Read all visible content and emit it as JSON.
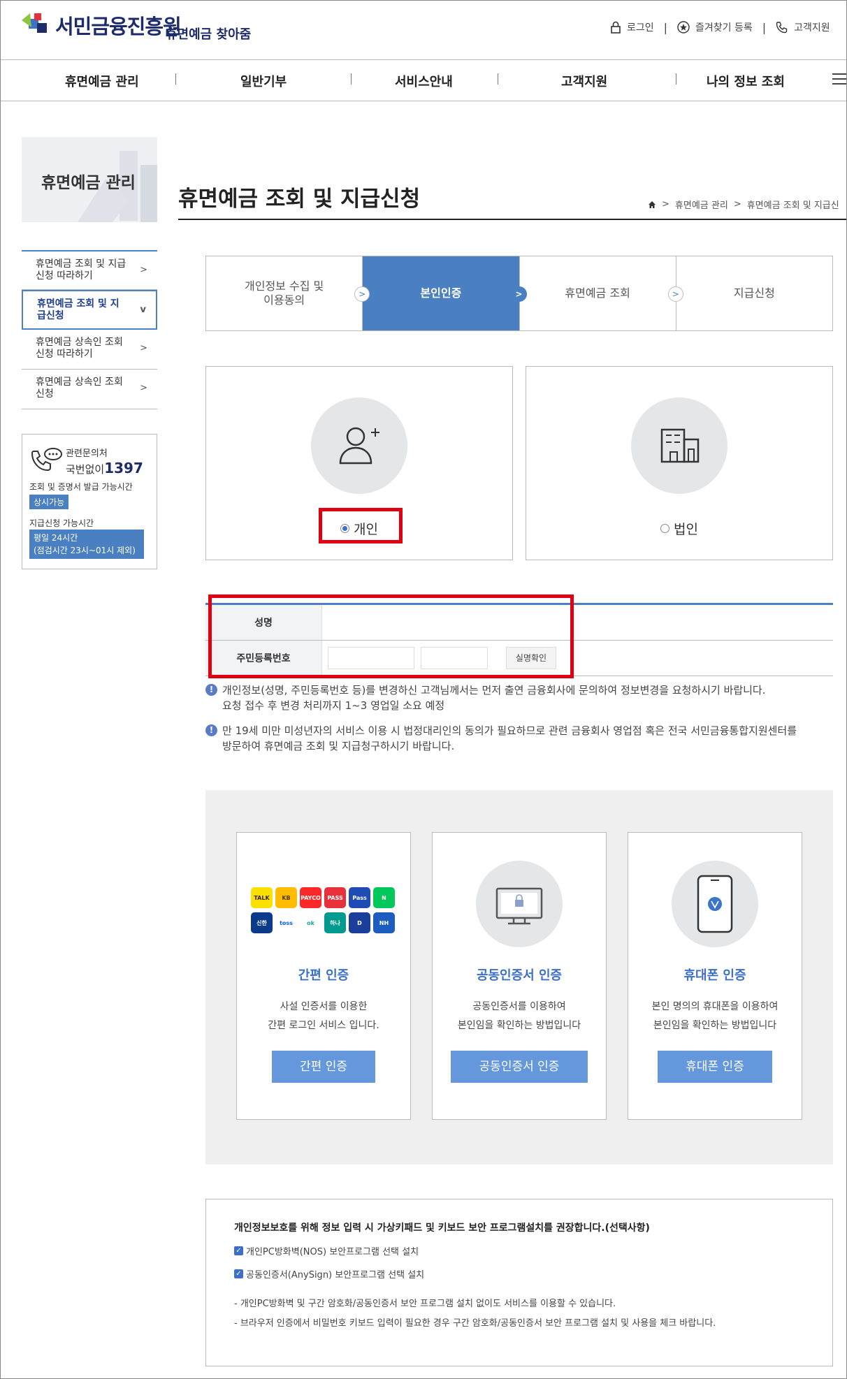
{
  "header": {
    "logo_text": "서민금융진흥원",
    "logo_sub": "휴면예금 찾아줌",
    "util": {
      "login": "로그인",
      "bookmark": "즐겨찾기 등록",
      "support": "고객지원"
    }
  },
  "gnb": [
    "휴면예금 관리",
    "일반기부",
    "서비스안내",
    "고객지원",
    "나의 정보 조회"
  ],
  "sidebar": {
    "title": "휴면예금 관리",
    "items": [
      {
        "label": "휴면예금 조회 및 지급신청 따라하기",
        "arrow": ">"
      },
      {
        "label": "휴면예금 조회 및 지급신청",
        "arrow": "v"
      },
      {
        "label": "휴면예금 상속인 조회신청 따라하기",
        "arrow": ">"
      },
      {
        "label": "휴면예금 상속인 조회신청",
        "arrow": ">"
      }
    ],
    "info": {
      "inquiry": "관련문의처",
      "no_area": "국번없이",
      "phone": "1397",
      "cert_time_label": "조회 및 증명서 발급 가능시간",
      "cert_time": "상시가능",
      "pay_time_label": "지급신청 가능시간",
      "pay_time_1": "평일 24시간",
      "pay_time_2": "(점검시간 23시~01시 제외)"
    }
  },
  "main": {
    "title": "휴면예금 조회 및 지급신청",
    "breadcrumb": [
      "휴면예금 관리",
      "휴면예금 조회 및 지급신"
    ],
    "steps": [
      {
        "label": "개인정보 수집 및 이용동의",
        "active": false
      },
      {
        "label": "본인인증",
        "active": true
      },
      {
        "label": "휴면예금 조회",
        "active": false
      },
      {
        "label": "지급신청",
        "active": false
      }
    ],
    "types": {
      "personal": "개인",
      "corporate": "법인",
      "selected": "개인"
    },
    "form": {
      "name_label": "성명",
      "name_value": "",
      "rrn_label": "주민등록번호",
      "rrn_value_1": "",
      "rrn_value_2": "",
      "verify_button": "실명확인"
    },
    "notes": [
      {
        "line1": "개인정보(성명, 주민등록번호 등)를 변경하신 고객님께서는 먼저 출연 금융회사에 문의하여 정보변경을 요청하시기 바랍니다.",
        "line2": "요청 접수 후 변경 처리까지 1~3 영업일 소요 예정"
      },
      {
        "line1": "만 19세 미만 미성년자의 서비스 이용 시 법정대리인의 동의가 필요하므로 관련 금융회사 영업점 혹은 전국 서민금융통합지원센터를",
        "line2": "방문하여 휴면예금 조회 및 지급청구하시기 바랍니다."
      }
    ],
    "auth": [
      {
        "title": "간편 인증",
        "desc1": "사설 인증서를 이용한",
        "desc2": "간편 로그인 서비스 입니다.",
        "button": "간편 인증"
      },
      {
        "title": "공동인증서 인증",
        "desc1": "공동인증서를 이용하여",
        "desc2": "본인임을 확인하는 방법입니다",
        "button": "공동인증서 인증"
      },
      {
        "title": "휴대폰 인증",
        "desc1": "본인 명의의 휴대폰을 이용하여",
        "desc2": "본인임을 확인하는 방법입니다",
        "button": "휴대폰 인증"
      }
    ],
    "apps": [
      {
        "label": "TALK",
        "color": "#fae100",
        "text_color": "#3c1e1e"
      },
      {
        "label": "KB",
        "color": "#ffbc00",
        "text_color": "#4a3a00"
      },
      {
        "label": "PAYCO",
        "color": "#fa2828",
        "text_color": "#ffffff"
      },
      {
        "label": "PASS",
        "color": "#e8303a",
        "text_color": "#ffffff"
      },
      {
        "label": "Pass",
        "color": "#1f4bb4",
        "text_color": "#ffffff"
      },
      {
        "label": "N",
        "color": "#03c75a",
        "text_color": "#ffffff"
      },
      {
        "label": "신한",
        "color": "#0a3a8a",
        "text_color": "#ffffff"
      },
      {
        "label": "toss",
        "color": "#ffffff",
        "text_color": "#0064ff"
      },
      {
        "label": "ok",
        "color": "#ffffff",
        "text_color": "#1aa58f"
      },
      {
        "label": "하나",
        "color": "#009b8f",
        "text_color": "#ffffff"
      },
      {
        "label": "D",
        "color": "#1a3f9a",
        "text_color": "#ffffff"
      },
      {
        "label": "NH",
        "color": "#1c5dbf",
        "text_color": "#ffffff"
      }
    ],
    "security": {
      "heading": "개인정보보호를 위해 정보 입력 시 가상키패드 및 키보드 보안 프로그램설치를 권장합니다.(선택사항)",
      "checks": [
        "개인PC방화벽(NOS) 보안프로그램 선택 설치",
        "공동인증서(AnySign) 보안프로그램 선택 설치"
      ],
      "notes": [
        "- 개인PC방화벽 및 구간 암호화/공동인증서 보안 프로그램 설치 없이도 서비스를 이용할 수 있습니다.",
        "- 브라우저 인증에서 비밀번호 키보드 입력이 필요한 경우 구간 암호화/공동인증서 보안 프로그램 설치 및 사용을 체크 바랍니다."
      ]
    }
  },
  "colors": {
    "brand": "#1d2b6b",
    "accent": "#4a7fc1",
    "button": "#6497db",
    "highlight": "#e00012"
  }
}
